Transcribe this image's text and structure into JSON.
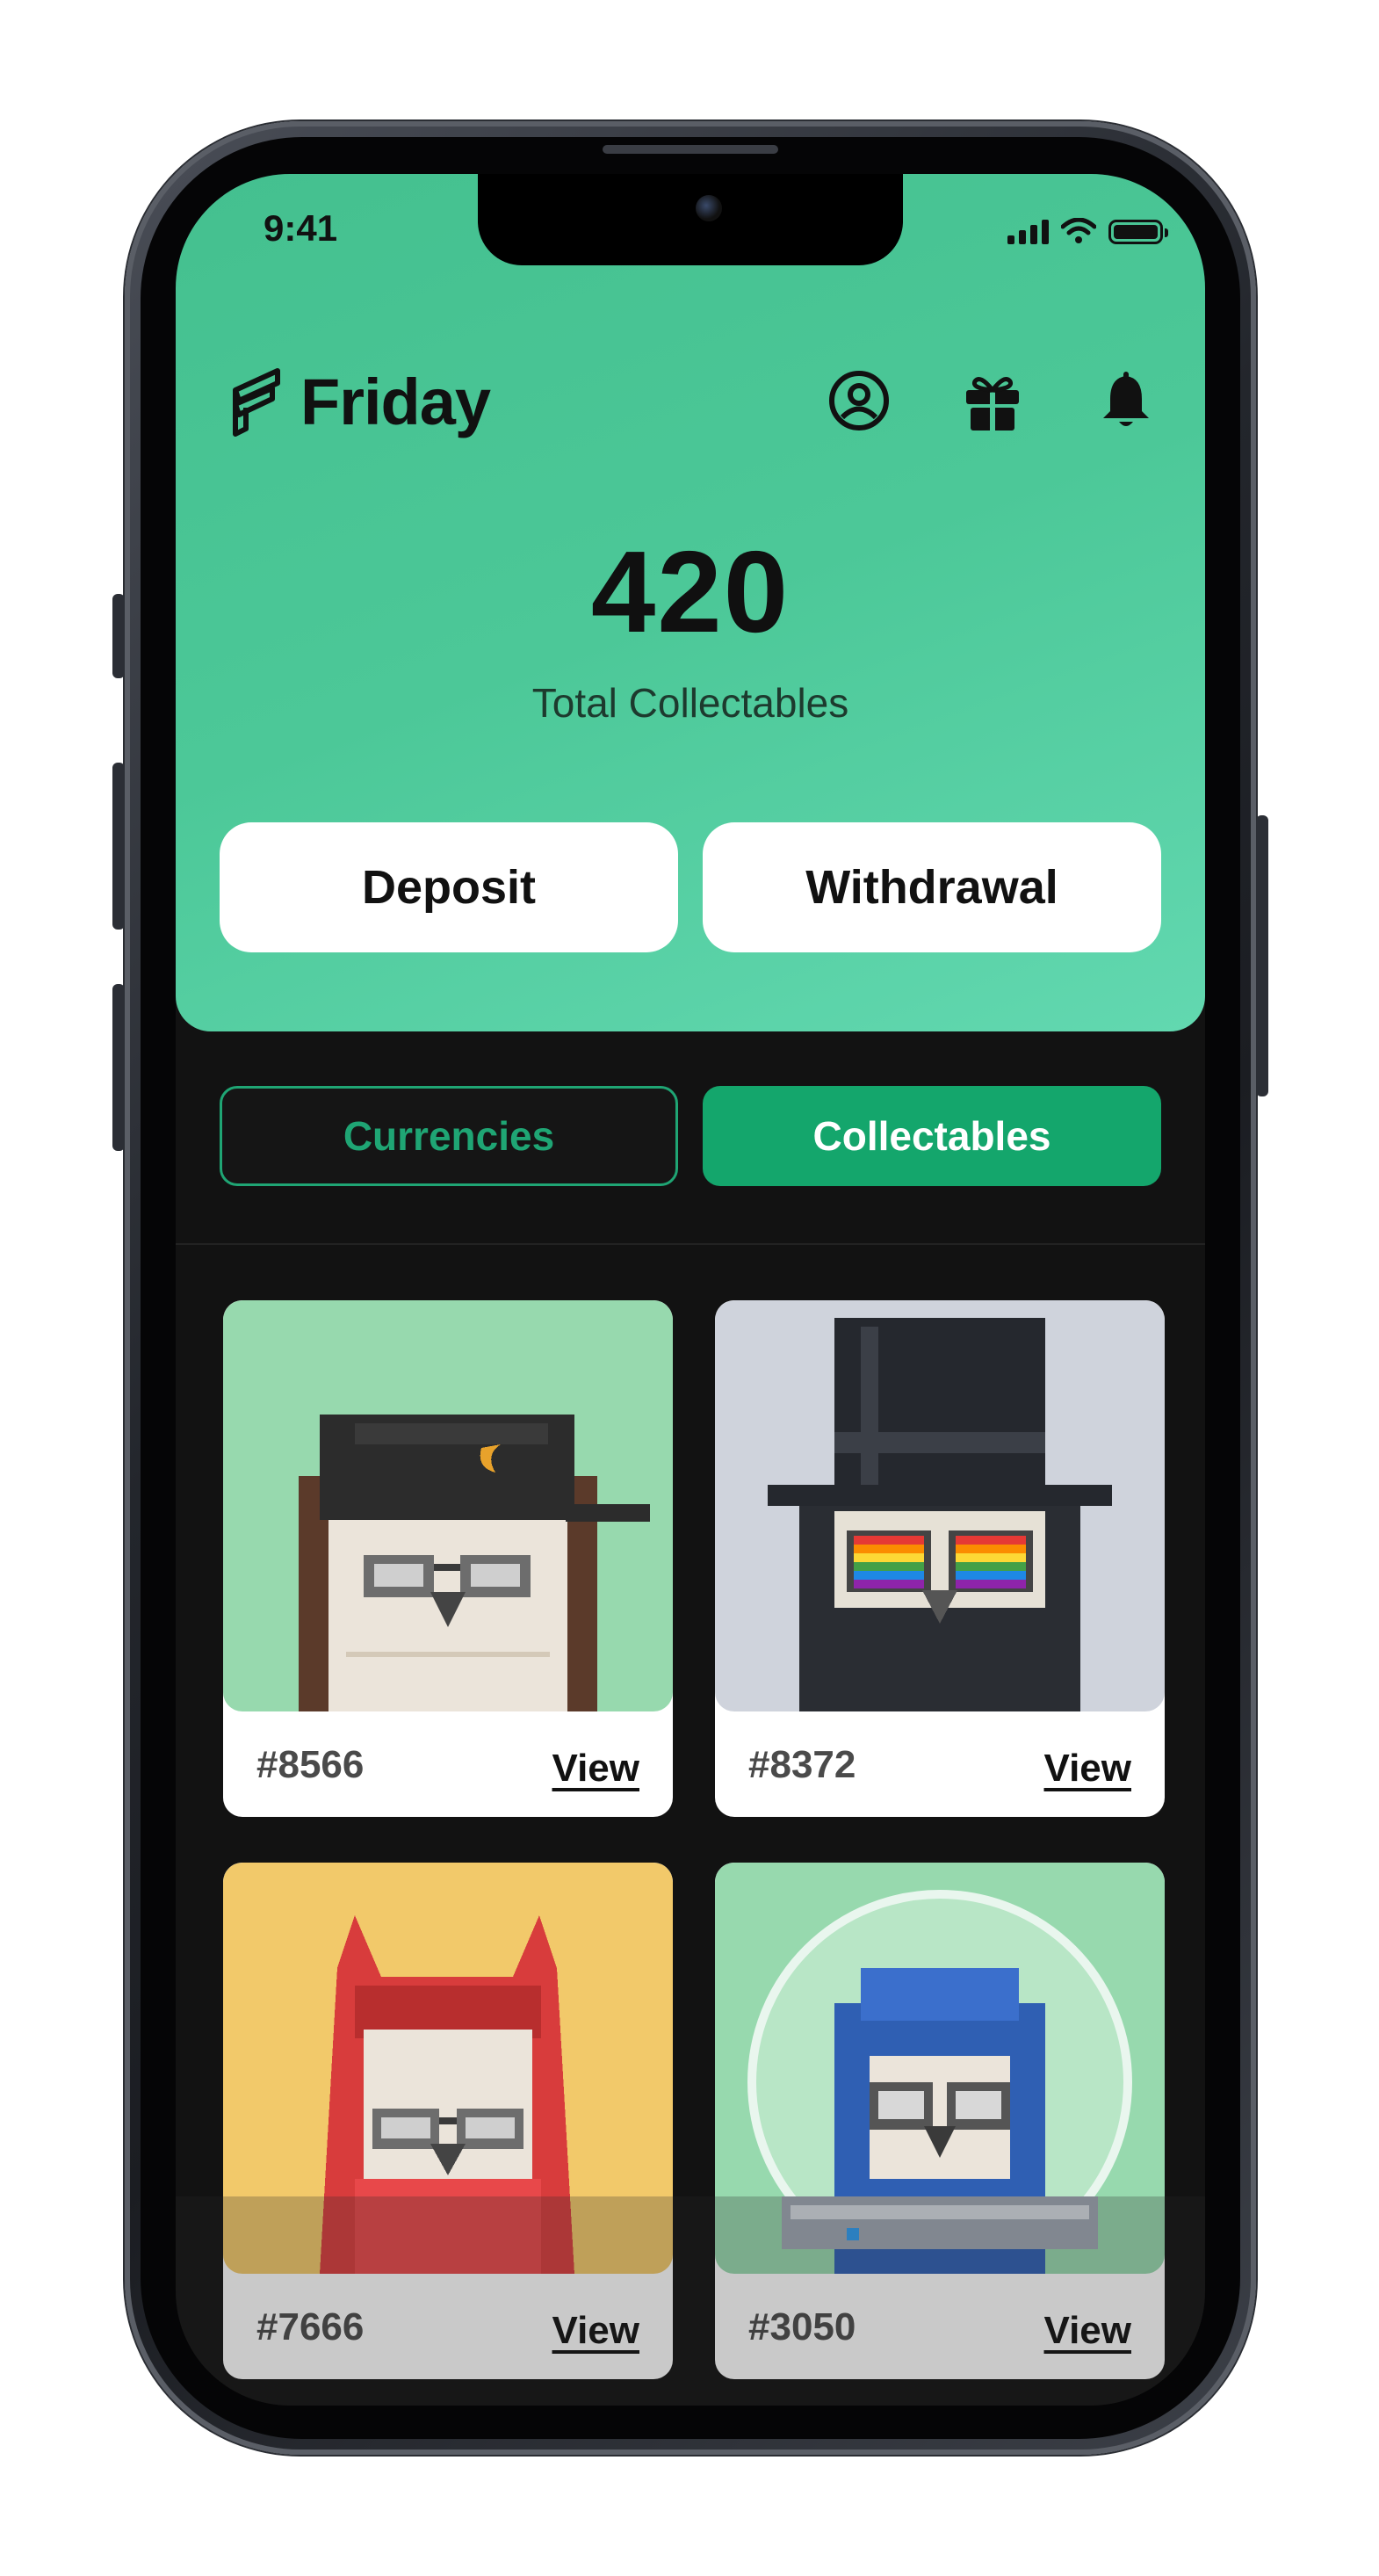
{
  "status_bar": {
    "time": "9:41"
  },
  "header": {
    "brand": "Friday"
  },
  "summary": {
    "count": "420",
    "label": "Total Collectables"
  },
  "actions": {
    "deposit": "Deposit",
    "withdrawal": "Withdrawal"
  },
  "tabs": {
    "currencies": "Currencies",
    "collectables": "Collectables",
    "active": "Collectables"
  },
  "collectables": [
    {
      "id": "#8566",
      "view": "View",
      "bg": "#97d9ae"
    },
    {
      "id": "#8372",
      "view": "View",
      "bg": "#cfd3dc"
    },
    {
      "id": "#7666",
      "view": "View",
      "bg": "#f2c96a"
    },
    {
      "id": "#3050",
      "view": "View",
      "bg": "#97d9ae"
    }
  ],
  "colors": {
    "accent": "#14a66c",
    "hero_green": "#4cc898"
  },
  "icons": [
    "profile-icon",
    "gift-icon",
    "bell-icon"
  ]
}
